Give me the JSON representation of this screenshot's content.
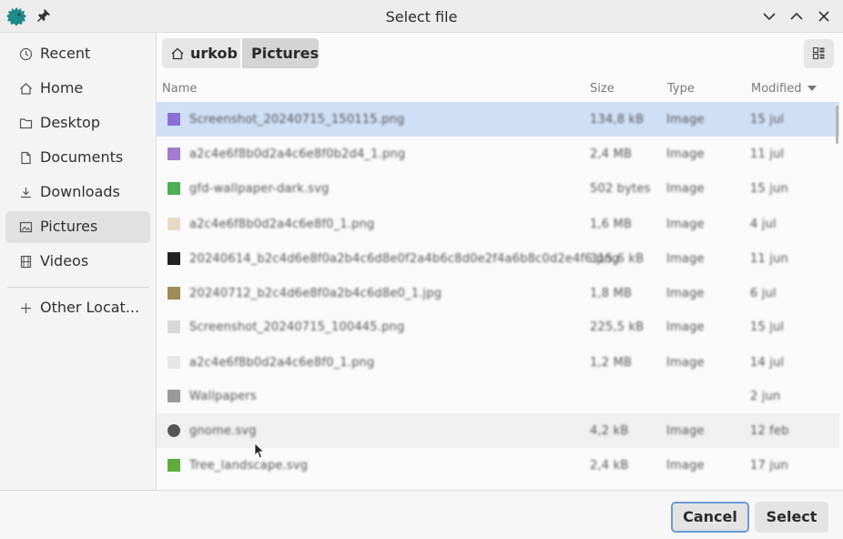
{
  "window": {
    "title": "Select file"
  },
  "sidebar": {
    "items": [
      {
        "label": "Recent",
        "icon": "clock-icon"
      },
      {
        "label": "Home",
        "icon": "home-icon"
      },
      {
        "label": "Desktop",
        "icon": "folder-icon"
      },
      {
        "label": "Documents",
        "icon": "document-icon"
      },
      {
        "label": "Downloads",
        "icon": "download-icon"
      },
      {
        "label": "Pictures",
        "icon": "image-icon",
        "active": true
      },
      {
        "label": "Videos",
        "icon": "film-icon"
      }
    ],
    "other": {
      "label": "Other Locat...",
      "icon": "plus-icon"
    }
  },
  "pathbar": {
    "home": "urkob",
    "current": "Pictures"
  },
  "columns": {
    "name": "Name",
    "size": "Size",
    "type": "Type",
    "modified": "Modified"
  },
  "files": [
    {
      "name": "Screenshot_20240715_150115.png",
      "size": "134,8 kB",
      "type": "Image",
      "modified": "15 jul",
      "color": "#8c6fd6",
      "selected": true
    },
    {
      "name": "a2c4e6f8b0d2a4c6e8f0b2d4_1.png",
      "size": "2,4 MB",
      "type": "Image",
      "modified": "11 jul",
      "color": "#a37bd1"
    },
    {
      "name": "gfd-wallpaper-dark.svg",
      "size": "502 bytes",
      "type": "Image",
      "modified": "15 jun",
      "color": "#4caf50"
    },
    {
      "name": "a2c4e6f8b0d2a4c6e8f0_1.png",
      "size": "1,6 MB",
      "type": "Image",
      "modified": "4 jul",
      "color": "#e9d8c4"
    },
    {
      "name": "20240614_b2c4d6e8f0a2b4c6d8e0f2a4b6c8d0e2f4a6b8c0d2e4f6.png",
      "size": "315,6 kB",
      "type": "Image",
      "modified": "11 jun",
      "color": "#222222"
    },
    {
      "name": "20240712_b2c4d6e8f0a2b4c6d8e0_1.jpg",
      "size": "1,8 MB",
      "type": "Image",
      "modified": "6 jul",
      "color": "#a08a55"
    },
    {
      "name": "Screenshot_20240715_100445.png",
      "size": "225,5 kB",
      "type": "Image",
      "modified": "15 jul",
      "color": "#d8d8d8"
    },
    {
      "name": "a2c4e6f8b0d2a4c6e8f0_1.png",
      "size": "1,2 MB",
      "type": "Image",
      "modified": "14 jul",
      "color": "#e6e6e6"
    },
    {
      "name": "Wallpapers",
      "size": "",
      "type": "",
      "modified": "2 jun",
      "color": "#9a9a9a"
    },
    {
      "name": "gnome.svg",
      "size": "4,2 kB",
      "type": "Image",
      "modified": "12 feb",
      "color": "#555555",
      "hover": true
    },
    {
      "name": "Tree_landscape.svg",
      "size": "2,4 kB",
      "type": "Image",
      "modified": "17 jun",
      "color": "#5fae3c"
    }
  ],
  "buttons": {
    "cancel": "Cancel",
    "select": "Select"
  },
  "colors": {
    "accent": "#6b9bd6",
    "selection": "#cfe0f6"
  }
}
